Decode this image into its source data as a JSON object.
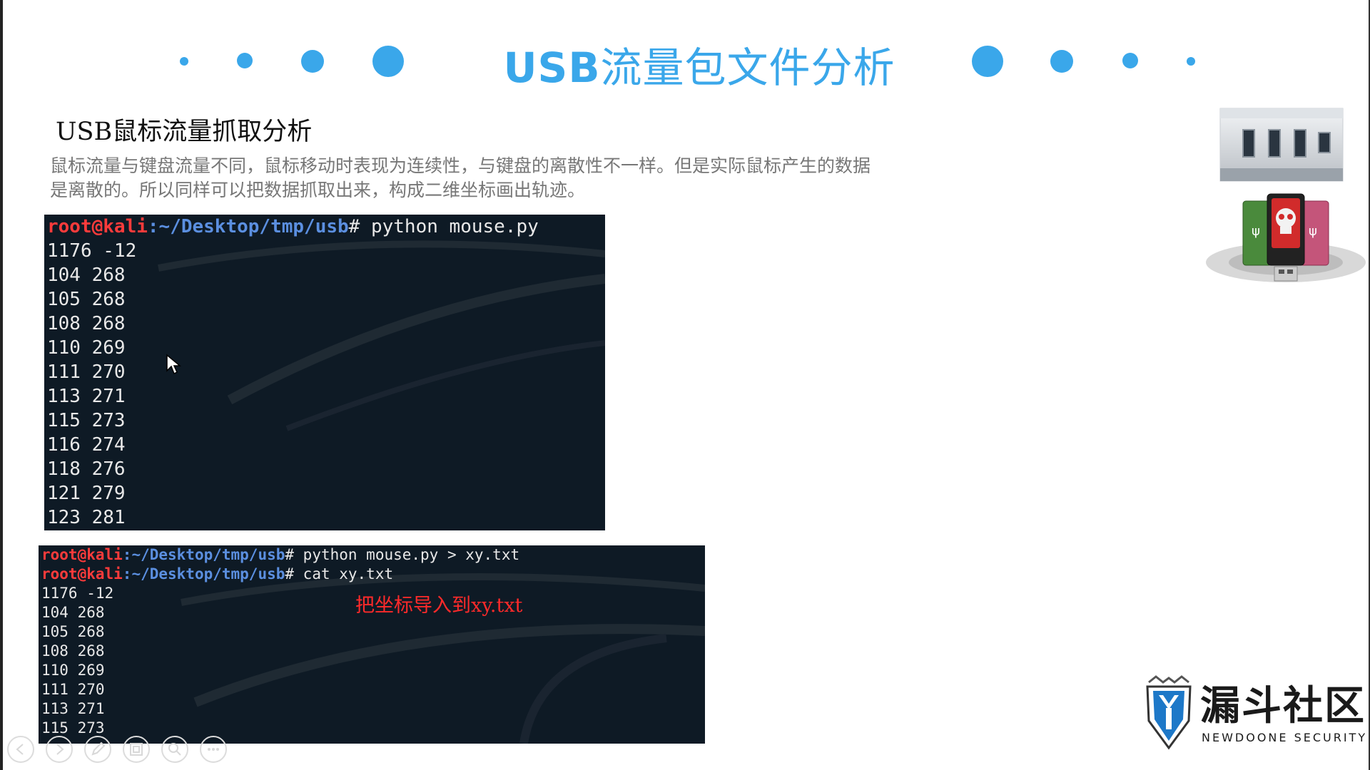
{
  "header": {
    "title_bold": "USB",
    "title_rest": "流量包文件分析",
    "accent_color": "#3aa7ea"
  },
  "content": {
    "subtitle": "USB鼠标流量抓取分析",
    "paragraph_line1": "鼠标流量与键盘流量不同，鼠标移动时表现为连续性，与键盘的离散性不一样。但是实际鼠标产生的数据",
    "paragraph_line2": "是离散的。所以同样可以把数据抓取出来，构成二维坐标画出轨迹。"
  },
  "terminal1": {
    "prompt_user": "root@kali",
    "prompt_path": ":~/Desktop/tmp/usb",
    "prompt_hash": "#",
    "command": " python mouse.py",
    "output": [
      "1176 -12",
      "104 268",
      "105 268",
      "108 268",
      "110 269",
      "111 270",
      "113 271",
      "115 273",
      "116 274",
      "118 276",
      "121 279",
      "123 281"
    ]
  },
  "terminal2": {
    "prompt_user": "root@kali",
    "prompt_path": ":~/Desktop/tmp/usb",
    "prompt_hash": "#",
    "command1": " python mouse.py > xy.txt",
    "command2": " cat xy.txt",
    "annotation": "把坐标导入到xy.txt",
    "output": [
      "1176 -12",
      "104 268",
      "105 268",
      "108 268",
      "110 269",
      "111 270",
      "113 271",
      "115 273"
    ]
  },
  "logo": {
    "name": "漏斗社区",
    "subtitle": "NEWDOONE SECURITY"
  },
  "controls": [
    "previous-icon",
    "next-icon",
    "pen-icon",
    "slides-icon",
    "zoom-icon",
    "more-icon"
  ]
}
